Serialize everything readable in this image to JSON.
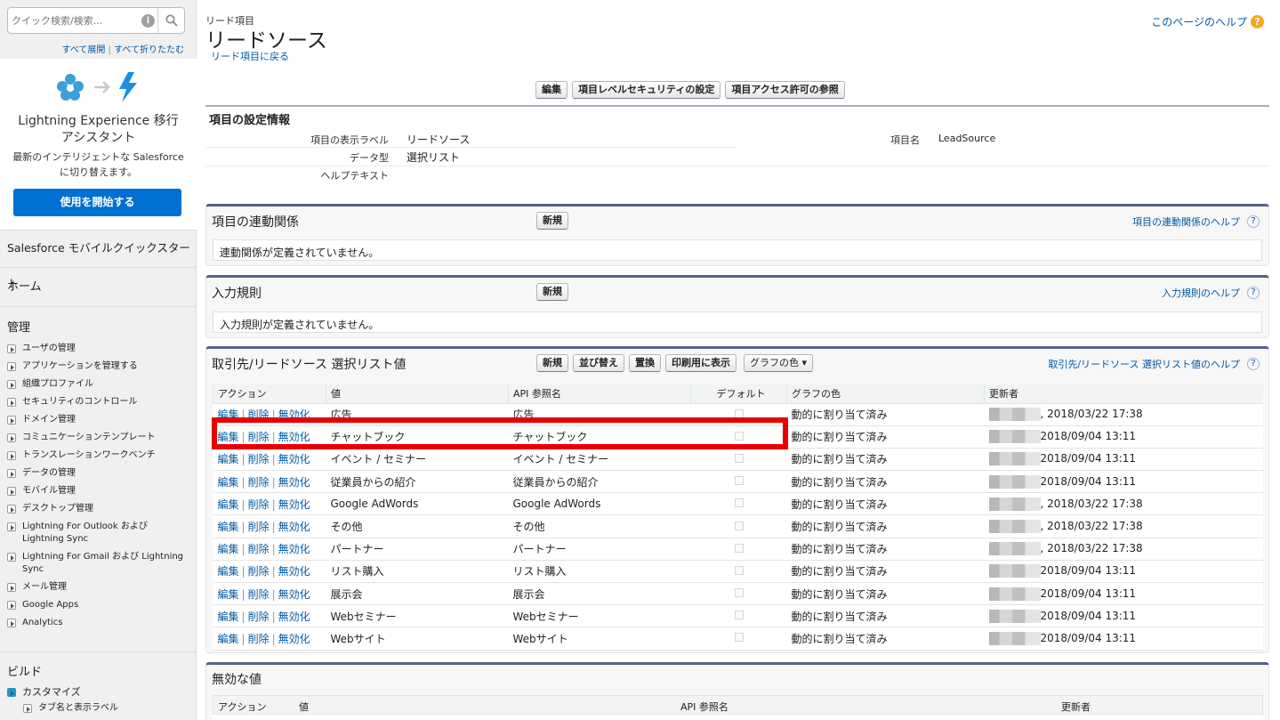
{
  "sidebar": {
    "search_placeholder": "クイック検索/検索...",
    "expand_all": "すべて展開",
    "divider": "|",
    "collapse_all": "すべて折りたたむ",
    "lightning": {
      "title1": "Lightning Experience 移行",
      "title2": "アシスタント",
      "desc": "最新のインテリジェントな Salesforce に切り替えます。",
      "button": "使用を開始する"
    },
    "mobile_quickstart": "Salesforce モバイルクイックスタート",
    "home": "ホーム",
    "admin_header": "管理",
    "admin_items": [
      "ユーザの管理",
      "アプリケーションを管理する",
      "組織プロファイル",
      "セキュリティのコントロール",
      "ドメイン管理",
      "コミュニケーションテンプレート",
      "トランスレーションワークベンチ",
      "データの管理",
      "モバイル管理",
      "デスクトップ管理",
      "Lightning For Outlook および Lightning Sync",
      "Lightning For Gmail および Lightning Sync",
      "メール管理",
      "Google Apps",
      "Analytics"
    ],
    "build_header": "ビルド",
    "customize": "カスタマイズ",
    "tabs_labels": "タブ名と表示ラベル"
  },
  "header": {
    "breadcrumb": "リード項目",
    "title": "リードソース",
    "back_link": "リード項目に戻る",
    "help_link": "このページのヘルプ",
    "buttons": [
      "編集",
      "項目レベルセキュリティの設定",
      "項目アクセス許可の参照"
    ]
  },
  "detail": {
    "section_title": "項目の設定情報",
    "label_label": "項目の表示ラベル",
    "label_value": "リードソース",
    "type_label": "データ型",
    "type_value": "選択リスト",
    "helptext_label": "ヘルプテキスト",
    "name_label": "項目名",
    "name_value": "LeadSource"
  },
  "dependencies": {
    "title": "項目の連動関係",
    "new_button": "新規",
    "help": "項目の連動関係のヘルプ",
    "empty": "連動関係が定義されていません。"
  },
  "validation": {
    "title": "入力規則",
    "new_button": "新規",
    "help": "入力規則のヘルプ",
    "empty": "入力規則が定義されていません。"
  },
  "picklist": {
    "title": "取引先/リードソース 選択リスト値",
    "buttons": [
      "新規",
      "並び替え",
      "置換",
      "印刷用に表示"
    ],
    "color_select": "グラフの色",
    "help": "取引先/リードソース 選択リスト値のヘルプ",
    "columns": [
      "アクション",
      "値",
      "API 参照名",
      "デフォルト",
      "グラフの色",
      "更新者"
    ],
    "actions": [
      "編集",
      "削除",
      "無効化"
    ],
    "action_sep": "|",
    "rows": [
      {
        "value": "広告",
        "api": "広告",
        "color": "動的に割り当て済み",
        "updated": ", 2018/03/22 17:38"
      },
      {
        "value": "チャットブック",
        "api": "チャットブック",
        "color": "動的に割り当て済み",
        "updated": "2018/09/04 13:11"
      },
      {
        "value": "イベント / セミナー",
        "api": "イベント / セミナー",
        "color": "動的に割り当て済み",
        "updated": "2018/09/04 13:11"
      },
      {
        "value": "従業員からの紹介",
        "api": "従業員からの紹介",
        "color": "動的に割り当て済み",
        "updated": "2018/09/04 13:11"
      },
      {
        "value": "Google AdWords",
        "api": "Google AdWords",
        "color": "動的に割り当て済み",
        "updated": ", 2018/03/22 17:38"
      },
      {
        "value": "その他",
        "api": "その他",
        "color": "動的に割り当て済み",
        "updated": ", 2018/03/22 17:38"
      },
      {
        "value": "パートナー",
        "api": "パートナー",
        "color": "動的に割り当て済み",
        "updated": ", 2018/03/22 17:38"
      },
      {
        "value": "リスト購入",
        "api": "リスト購入",
        "color": "動的に割り当て済み",
        "updated": "2018/09/04 13:11"
      },
      {
        "value": "展示会",
        "api": "展示会",
        "color": "動的に割り当て済み",
        "updated": "2018/09/04 13:11"
      },
      {
        "value": "Webセミナー",
        "api": "Webセミナー",
        "color": "動的に割り当て済み",
        "updated": "2018/09/04 13:11"
      },
      {
        "value": "Webサイト",
        "api": "Webサイト",
        "color": "動的に割り当て済み",
        "updated": "2018/09/04 13:11"
      }
    ]
  },
  "inactive": {
    "title": "無効な値",
    "columns": [
      "アクション",
      "値",
      "API 参照名",
      "更新者"
    ]
  }
}
